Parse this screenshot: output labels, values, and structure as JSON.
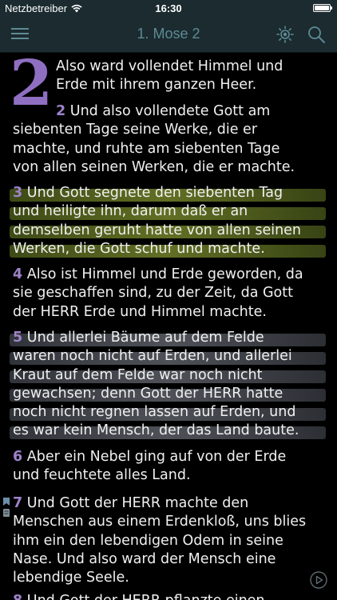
{
  "status_bar": {
    "carrier": "Netzbetreiber",
    "time": "16:30"
  },
  "nav": {
    "title": "1. Mose 2"
  },
  "chapter": {
    "number": "2"
  },
  "verses": [
    {
      "num": "",
      "lines": [
        "Also ward vollendet Himmel und",
        "Erde mit ihrem ganzen Heer."
      ]
    },
    {
      "num": "2",
      "lines": [
        "Und also vollendete Gott am",
        "siebenten Tage seine Werke, die er",
        "machte, und ruhte am siebenten Tage",
        "von allen seinen Werken, die er machte."
      ]
    },
    {
      "num": "3",
      "lines": [
        "Und Gott segnete den siebenten Tag",
        "und heiligte ihn, darum daß er an",
        "demselben geruht hatte von allen seinen",
        "Werken, die Gott schuf und machte."
      ]
    },
    {
      "num": "4",
      "lines": [
        "Also ist Himmel und Erde geworden, da",
        "sie geschaffen sind, zu der Zeit, da Gott",
        "der HERR Erde und Himmel machte."
      ]
    },
    {
      "num": "5",
      "lines": [
        "Und allerlei Bäume auf dem Felde",
        "waren noch nicht auf Erden, und allerlei",
        "Kraut auf dem Felde war noch nicht",
        "gewachsen; denn Gott der HERR hatte",
        "noch nicht regnen lassen auf Erden, und",
        "es war kein Mensch, der das Land baute."
      ]
    },
    {
      "num": "6",
      "lines": [
        "Aber ein Nebel ging auf von der Erde",
        "und feuchtete alles Land."
      ]
    },
    {
      "num": "7",
      "lines": [
        "Und Gott der HERR machte den",
        "Menschen aus einem Erdenkloß, uns blies",
        "ihm ein den lebendigen Odem in seine",
        "Nase. Und also ward der Mensch eine",
        "lebendige Seele."
      ]
    },
    {
      "num": "8",
      "lines": [
        "Und Gott der HERR pflanzte einen"
      ]
    }
  ],
  "highlights": {
    "verse_3": "green",
    "verse_5": "gray"
  }
}
